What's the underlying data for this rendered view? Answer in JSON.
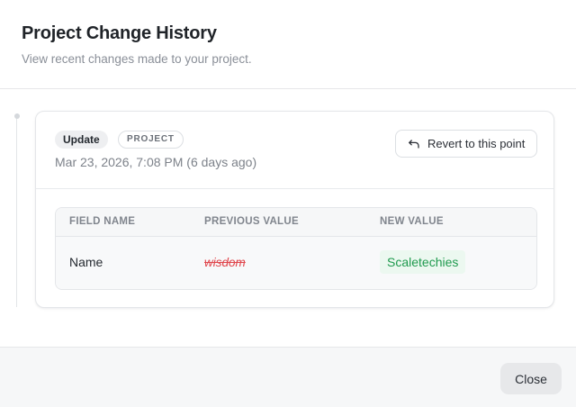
{
  "dialog": {
    "title": "Project Change History",
    "subtitle": "View recent changes made to your project."
  },
  "entries": [
    {
      "action": "Update",
      "scope": "PROJECT",
      "timestamp": "Mar 23, 2026, 7:08 PM (6 days ago)",
      "revert_label": "Revert to this point",
      "table": {
        "headers": [
          "FIELD NAME",
          "PREVIOUS VALUE",
          "NEW VALUE"
        ],
        "rows": [
          {
            "field": "Name",
            "previous": "wisdom",
            "new": "Scaletechies"
          }
        ]
      }
    }
  ],
  "footer": {
    "close_label": "Close"
  },
  "colors": {
    "removed": "#e0464c",
    "added": "#1f9a4e",
    "added_bg": "#ecf8f0"
  },
  "icons": {
    "revert": "undo-arrow-icon"
  }
}
